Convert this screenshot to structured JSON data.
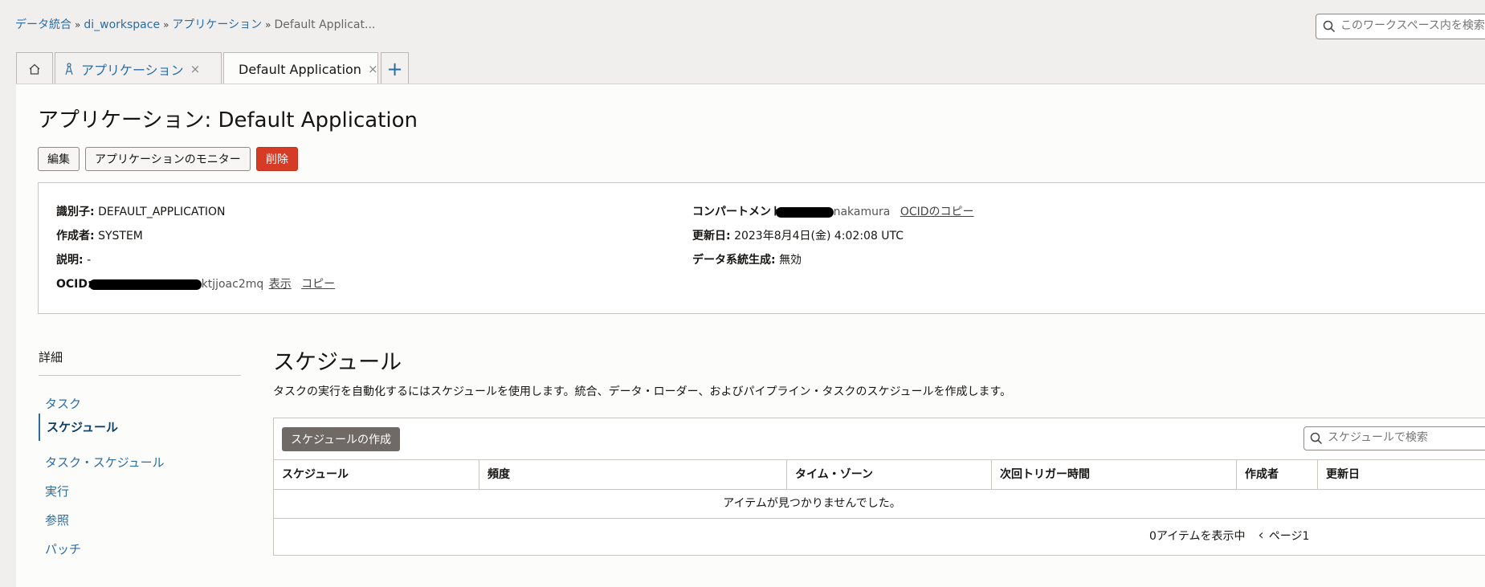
{
  "breadcrumb": {
    "items": [
      "データ統合",
      "di_workspace",
      "アプリケーション"
    ],
    "current": "Default Applicat...",
    "separator": "»"
  },
  "search": {
    "placeholder": "このワークスペース内を検索"
  },
  "tabs": [
    {
      "icon": "home-icon"
    },
    {
      "label": "アプリケーション",
      "icon": "application-icon",
      "close": "×"
    },
    {
      "label": "Default Application",
      "icon": "application-icon",
      "close": "×",
      "active": true
    },
    {
      "label": "+",
      "icon": "plus-icon"
    }
  ],
  "page": {
    "title": "アプリケーション: Default Application"
  },
  "actions": {
    "edit": "編集",
    "monitor": "アプリケーションのモニター",
    "delete": "削除"
  },
  "details": {
    "identifier_label": "識別子:",
    "identifier_value": "DEFAULT_APPLICATION",
    "creator_label": "作成者:",
    "creator_value": "SYSTEM",
    "description_label": "説明:",
    "description_value": "-",
    "ocid_label": "OCID:",
    "ocid_suffix": "ktjjoac2mq",
    "ocid_show": "表示",
    "ocid_copy": "コピー",
    "compartment_label": "コンパートメント:",
    "compartment_suffix": "nakamura",
    "compartment_copy": "OCIDのコピー",
    "updated_label": "更新日:",
    "updated_value": "2023年8月4日(金) 4:02:08 UTC",
    "lineage_label": "データ系統生成:",
    "lineage_value": "無効"
  },
  "sidebar": {
    "heading": "詳細",
    "items": [
      {
        "label": "タスク"
      },
      {
        "label": "スケジュール",
        "selected": true
      },
      {
        "label": "タスク・スケジュール"
      },
      {
        "label": "実行"
      },
      {
        "label": "参照"
      },
      {
        "label": "パッチ"
      }
    ]
  },
  "schedules": {
    "title": "スケジュール",
    "description": "タスクの実行を自動化するにはスケジュールを使用します。統合、データ・ローダー、およびパイプライン・タスクのスケジュールを作成します。",
    "create_button": "スケジュールの作成",
    "search_placeholder": "スケジュールで検索",
    "columns": [
      "スケジュール",
      "頻度",
      "タイム・ゾーン",
      "次回トリガー時間",
      "作成者",
      "更新日"
    ],
    "rows": [],
    "empty_message": "アイテムが見つかりませんでした。",
    "footer_count": "0アイテムを表示中",
    "footer_page": "ページ1"
  }
}
